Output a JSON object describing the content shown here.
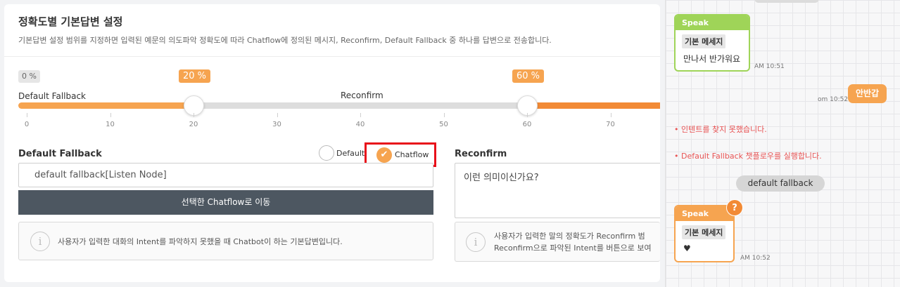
{
  "settings": {
    "title": "정확도별 기본답변 설정",
    "description": "기본답변 설정 범위를 지정하면 입력된 예문의 의도파악 정확도에 따라 Chatflow에 정의된 메시지, Reconfirm, Default Fallback 중 하나를 답변으로 전송합니다.",
    "slider": {
      "min_label": "0 %",
      "low_threshold_label": "20 %",
      "high_threshold_label": "60 %",
      "low_threshold": 20,
      "high_threshold": 60,
      "zone_left_label": "Default Fallback",
      "zone_mid_label": "Reconfirm",
      "ticks": [
        "0",
        "10",
        "20",
        "30",
        "40",
        "50",
        "60",
        "70"
      ]
    },
    "default_fallback": {
      "title": "Default Fallback",
      "radio_default_label": "Default",
      "radio_chatflow_label": "Chatflow",
      "selected": "Chatflow",
      "input_value": "default fallback[Listen Node]",
      "move_button_label": "선택한 Chatflow로 이동",
      "info_text": "사용자가 입력한 대화의 Intent를 파악하지 못했을 때 Chatbot이 하는 기본답변입니다."
    },
    "reconfirm": {
      "title": "Reconfirm",
      "text_value": "이런 의미이신가요?",
      "info_line1": "사용자가 입력한 말의 정확도가 Reconfirm 범",
      "info_line2": "Reconfirm으로 파악된 Intent를 버튼으로 보여"
    }
  },
  "chat": {
    "bot_message_1": {
      "header": "Speak",
      "chip": "기본 메세지",
      "body": "만나서 반가워요",
      "time": "AM 10:51"
    },
    "user_message": {
      "text": "안반갑",
      "time": "om 10:52"
    },
    "system_notice_1": "• 인텐트를 찾지 못했습니다.",
    "system_notice_2": "• Default Fallback 챗플로우를 실행합니다.",
    "fallback_pill": "default fallback",
    "bot_message_2": {
      "header": "Speak",
      "chip": "기본 메세지",
      "body": "♥",
      "badge": "?",
      "time": "AM 10:52"
    }
  },
  "colors": {
    "accent_orange": "#f6a450",
    "deep_orange": "#f28a35",
    "speak_green": "#9fd458",
    "dark_button": "#4d5761",
    "highlight_red": "#e8101a",
    "error_red": "#e85454"
  }
}
